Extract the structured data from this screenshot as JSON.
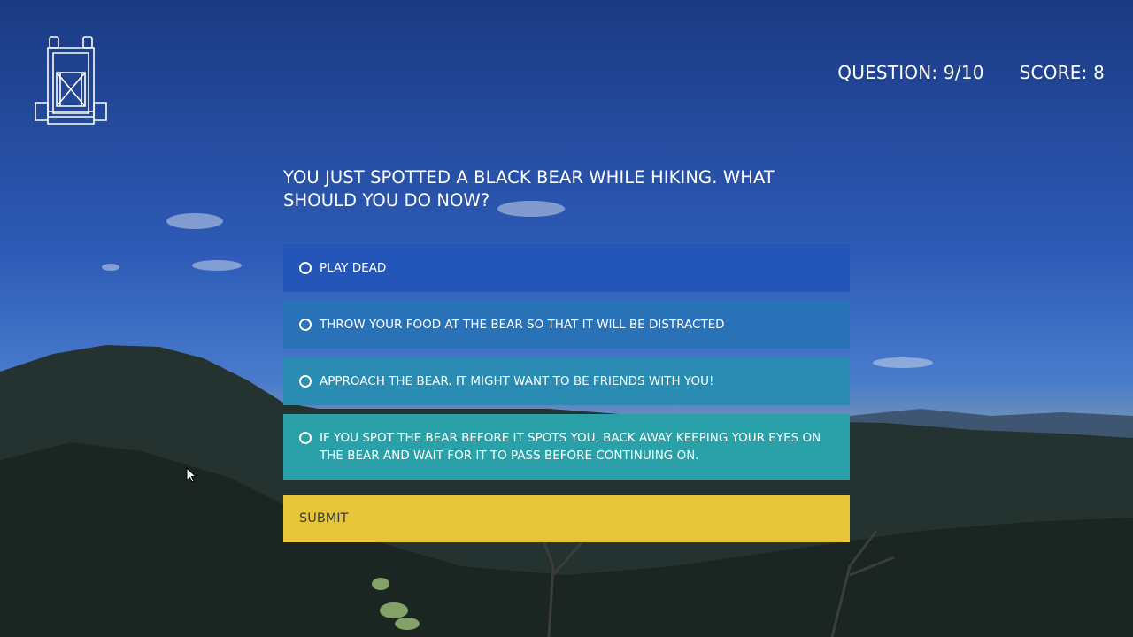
{
  "header": {
    "logo_icon": "backpack-icon",
    "question_counter": "QUESTION: 9/10",
    "score": "SCORE: 8"
  },
  "quiz": {
    "question": "YOU JUST SPOTTED A BLACK BEAR WHILE HIKING. WHAT SHOULD YOU DO NOW?",
    "answers": [
      {
        "label": "PLAY DEAD",
        "color": "#2356b8"
      },
      {
        "label": "THROW YOUR FOOD AT THE BEAR SO THAT IT WILL BE DISTRACTED",
        "color": "#2a72b8"
      },
      {
        "label": "APPROACH THE BEAR. IT MIGHT WANT TO BE FRIENDS WITH YOU!",
        "color": "#2a8cb2"
      },
      {
        "label": "IF YOU SPOT THE BEAR BEFORE IT SPOTS YOU, BACK AWAY KEEPING YOUR EYES ON THE BEAR AND WAIT FOR IT TO PASS BEFORE CONTINUING ON.",
        "color": "#2aa1a8"
      }
    ],
    "submit_label": "SUBMIT",
    "submit_color": "#e7c53a"
  }
}
